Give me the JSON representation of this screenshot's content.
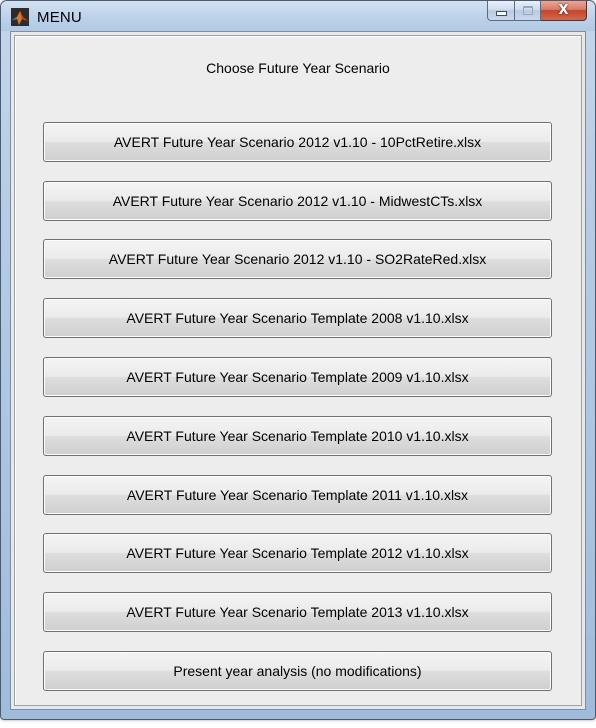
{
  "window": {
    "title": "MENU",
    "app_icon": "matlab-icon",
    "controls": {
      "minimize_icon": "minimize-icon",
      "maximize_icon": "maximize-icon",
      "close_icon": "close-icon",
      "close_glyph": "X"
    }
  },
  "menu": {
    "heading": "Choose Future Year Scenario",
    "buttons": [
      {
        "label": "AVERT Future Year Scenario 2012 v1.10 - 10PctRetire.xlsx"
      },
      {
        "label": "AVERT Future Year Scenario 2012 v1.10 - MidwestCTs.xlsx"
      },
      {
        "label": "AVERT Future Year Scenario 2012 v1.10 - SO2RateRed.xlsx"
      },
      {
        "label": "AVERT Future Year Scenario Template 2008 v1.10.xlsx"
      },
      {
        "label": "AVERT Future Year Scenario Template 2009 v1.10.xlsx"
      },
      {
        "label": "AVERT Future Year Scenario Template 2010 v1.10.xlsx"
      },
      {
        "label": "AVERT Future Year Scenario Template 2011 v1.10.xlsx"
      },
      {
        "label": "AVERT Future Year Scenario Template 2012 v1.10.xlsx"
      },
      {
        "label": "AVERT Future Year Scenario Template 2013 v1.10.xlsx"
      },
      {
        "label": "Present year analysis (no modifications)"
      }
    ]
  },
  "colors": {
    "title_bar": "#bfd3ea",
    "close_button": "#c2462e",
    "panel_background": "#ededed",
    "button_face": "#e6e6e6"
  }
}
